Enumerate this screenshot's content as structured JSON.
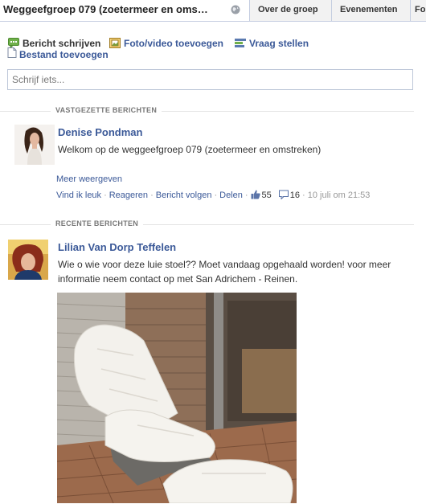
{
  "header": {
    "group_title": "Weggeefgroep 079 (zoetermeer en oms…",
    "tabs": [
      {
        "label": "Over de groep"
      },
      {
        "label": "Evenementen"
      },
      {
        "label": "Fo"
      }
    ]
  },
  "composer": {
    "write_post": "Bericht schrijven",
    "add_photo_video": "Foto/video toevoegen",
    "ask_question": "Vraag stellen",
    "add_file": "Bestand toevoegen",
    "placeholder": "Schrijf iets..."
  },
  "pinned": {
    "section_label": "VASTGEZETTE BERICHTEN",
    "author": "Denise Pondman",
    "message": "Welkom op de weggeefgroep 079 (zoetermeer en omstreken)",
    "see_more": "Meer weergeven",
    "actions": {
      "like": "Vind ik leuk",
      "comment": "Reageren",
      "follow": "Bericht volgen",
      "share": "Delen",
      "likes_count": "55",
      "comments_count": "16",
      "timestamp": "10 juli om 21:53"
    }
  },
  "recent": {
    "section_label": "RECENTE BERICHTEN",
    "author": "Lilian Van Dorp Teffelen",
    "message": "Wie o wie voor deze luie stoel?? Moet vandaag opgehaald worden! voor meer informatie neem contact op met San Adrichem - Reinen."
  },
  "colors": {
    "link": "#3b5998",
    "border": "#bdc7d8",
    "muted": "#777777"
  }
}
